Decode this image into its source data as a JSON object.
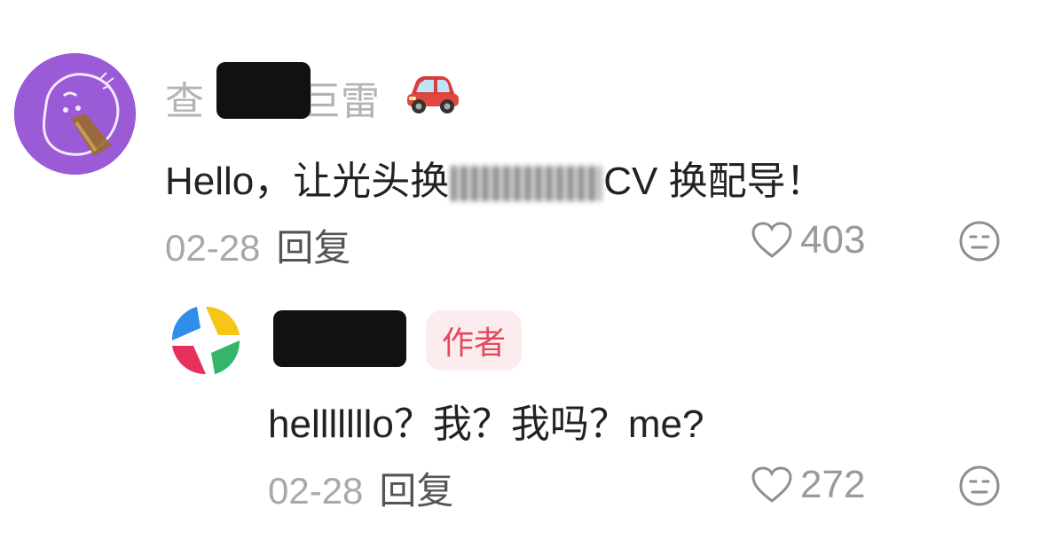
{
  "main_comment": {
    "username_prefix": "查",
    "username_suffix": "巨雷",
    "car_emoji": "car-icon",
    "text_prefix": "Hello，让光头换",
    "text_suffix": "CV 换配导！",
    "date": "02-28",
    "reply_label": "回复",
    "like_count": "403"
  },
  "reply_comment": {
    "author_badge": "作者",
    "text": "helllllllo？我？我吗？me?",
    "date": "02-28",
    "reply_label": "回复",
    "like_count": "272"
  },
  "colors": {
    "avatar_purple": "#9b5ad6",
    "badge_bg": "#fdecee",
    "badge_text": "#e24a5a"
  }
}
